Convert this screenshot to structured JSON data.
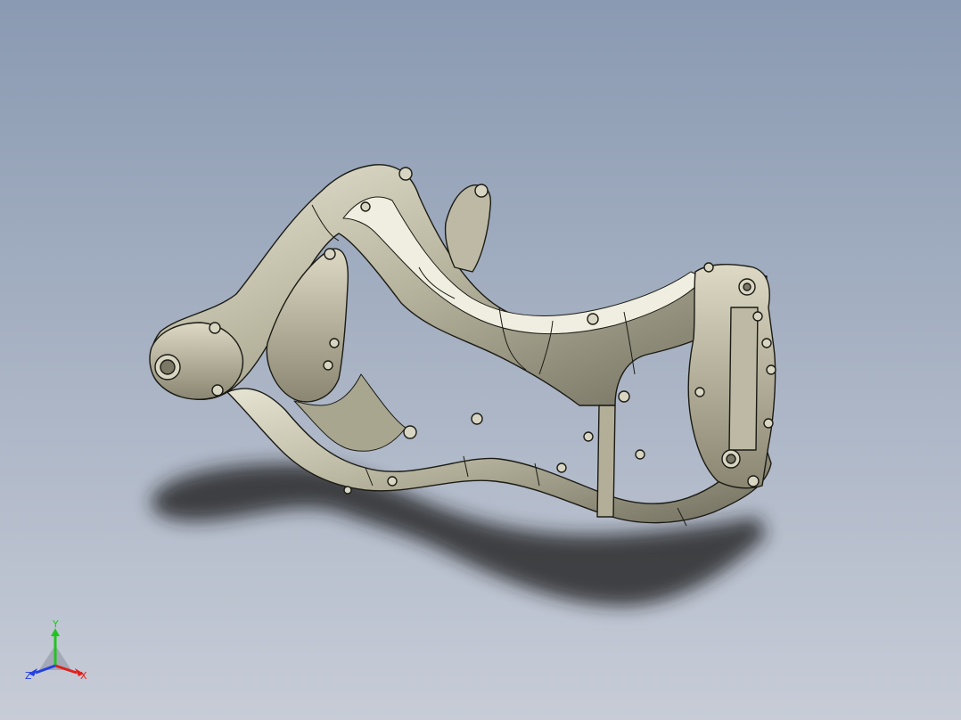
{
  "viewport": {
    "background_top": "#8a9ab2",
    "background_bottom": "#c7ccd7",
    "model_color": "#c3c1ad",
    "edge_color": "#1b1b14",
    "shadow_color": "#1c1c1c"
  },
  "triad": {
    "x_label": "X",
    "y_label": "Y",
    "z_label": "Z",
    "x_color": "#e0201c",
    "y_color": "#22c422",
    "z_color": "#2440e0"
  }
}
